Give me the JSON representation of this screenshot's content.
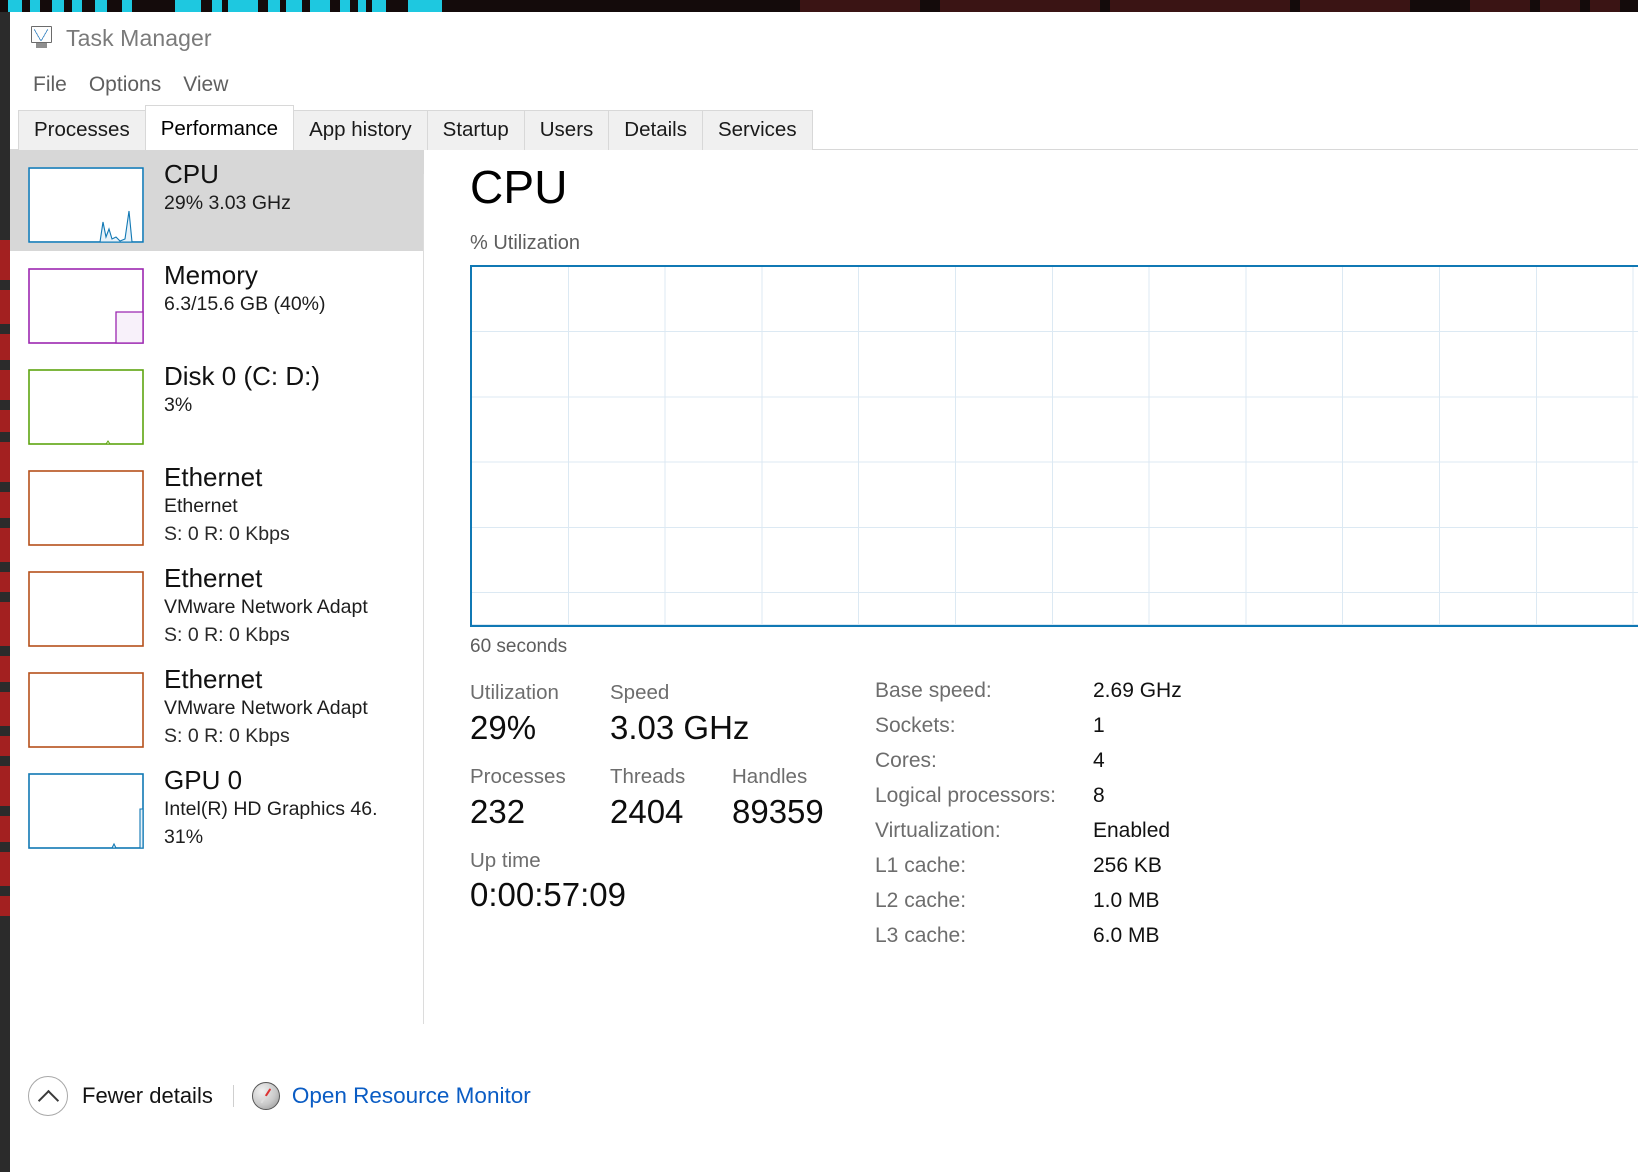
{
  "window": {
    "title": "Task Manager",
    "icon": "task-manager-icon"
  },
  "menu": {
    "items": [
      "File",
      "Options",
      "View"
    ]
  },
  "tabs": [
    {
      "label": "Processes",
      "active": false
    },
    {
      "label": "Performance",
      "active": true
    },
    {
      "label": "App history",
      "active": false
    },
    {
      "label": "Startup",
      "active": false
    },
    {
      "label": "Users",
      "active": false
    },
    {
      "label": "Details",
      "active": false
    },
    {
      "label": "Services",
      "active": false
    }
  ],
  "sidebar": {
    "items": [
      {
        "name": "CPU",
        "line2": "29%  3.03 GHz",
        "line3": "",
        "color": "#1078b4",
        "selected": true
      },
      {
        "name": "Memory",
        "line2": "6.3/15.6 GB (40%)",
        "line3": "",
        "color": "#9c27b0",
        "selected": false
      },
      {
        "name": "Disk 0 (C: D:)",
        "line2": "3%",
        "line3": "",
        "color": "#5ea511",
        "selected": false
      },
      {
        "name": "Ethernet",
        "line2": "Ethernet",
        "line3": "S: 0 R: 0 Kbps",
        "color": "#b5501a",
        "selected": false
      },
      {
        "name": "Ethernet",
        "line2": "VMware Network Adapt",
        "line3": "S: 0 R: 0 Kbps",
        "color": "#b5501a",
        "selected": false
      },
      {
        "name": "Ethernet",
        "line2": "VMware Network Adapt",
        "line3": "S: 0 R: 0 Kbps",
        "color": "#b5501a",
        "selected": false
      },
      {
        "name": "GPU 0",
        "line2": "Intel(R) HD Graphics 46.",
        "line3": "31%",
        "color": "#1078b4",
        "selected": false
      }
    ]
  },
  "detail": {
    "title": "CPU",
    "graph_label": "% Utilization",
    "graph_footer": "60 seconds",
    "stats": {
      "utilization_label": "Utilization",
      "utilization_value": "29%",
      "speed_label": "Speed",
      "speed_value": "3.03 GHz",
      "processes_label": "Processes",
      "processes_value": "232",
      "threads_label": "Threads",
      "threads_value": "2404",
      "handles_label": "Handles",
      "handles_value": "89359",
      "uptime_label": "Up time",
      "uptime_value": "0:00:57:09"
    },
    "specs": [
      {
        "key": "Base speed:",
        "value": "2.69 GHz"
      },
      {
        "key": "Sockets:",
        "value": "1"
      },
      {
        "key": "Cores:",
        "value": "4"
      },
      {
        "key": "Logical processors:",
        "value": "8"
      },
      {
        "key": "Virtualization:",
        "value": "Enabled"
      },
      {
        "key": "L1 cache:",
        "value": "256 KB"
      },
      {
        "key": "L2 cache:",
        "value": "1.0 MB"
      },
      {
        "key": "L3 cache:",
        "value": "6.0 MB"
      }
    ]
  },
  "footer": {
    "chevron_icon": "chevron-up-icon",
    "fewer_details": "Fewer details",
    "resource_monitor_icon": "resource-monitor-icon",
    "open_resource_monitor": "Open Resource Monitor"
  },
  "chart_data": {
    "type": "line",
    "title": "CPU",
    "ylabel": "% Utilization",
    "xlabel": "60 seconds",
    "ylim": [
      0,
      100
    ],
    "xlim": [
      0,
      60
    ],
    "grid": true,
    "gridlines_x": 12,
    "gridlines_y": 10,
    "series": [
      {
        "name": "% Utilization",
        "values": []
      }
    ],
    "current_value": 29,
    "accent_color": "#1078b4"
  }
}
